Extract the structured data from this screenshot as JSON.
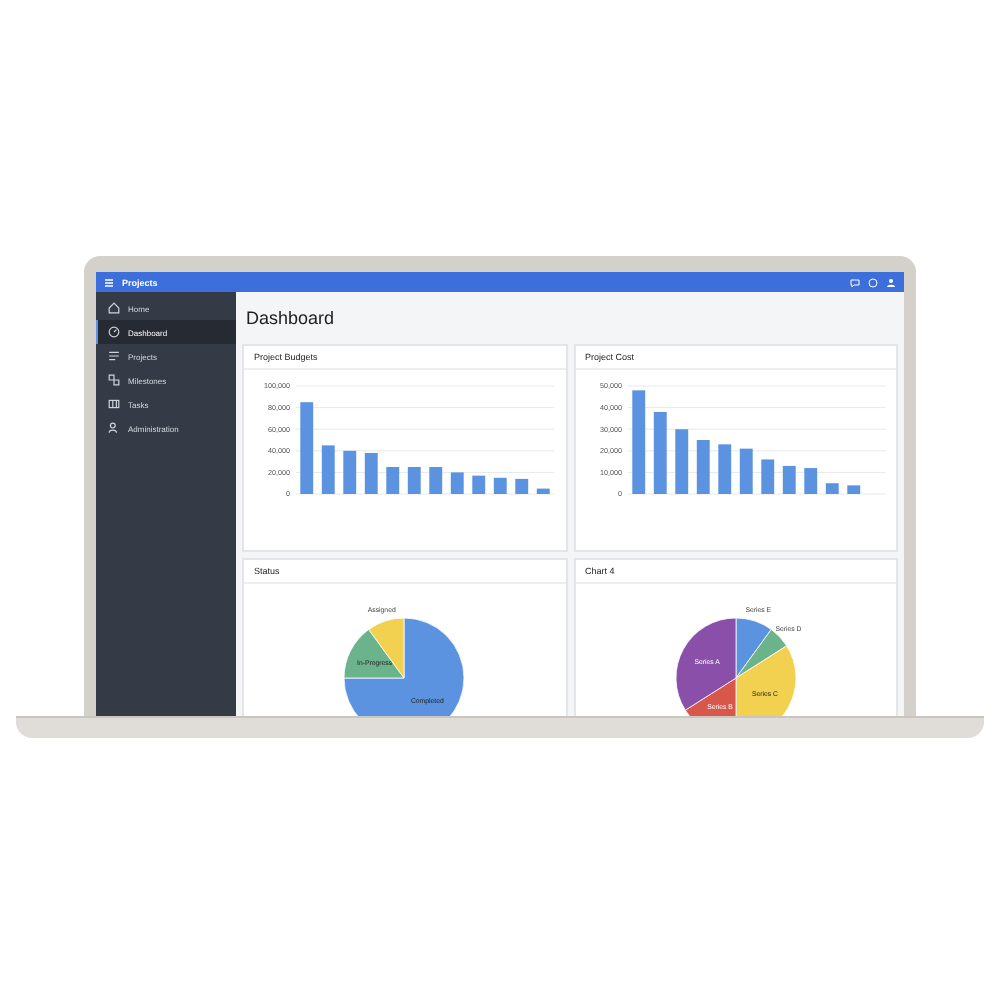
{
  "header": {
    "title": "Projects"
  },
  "sidebar": {
    "items": [
      {
        "label": "Home",
        "selected": false
      },
      {
        "label": "Dashboard",
        "selected": true
      },
      {
        "label": "Projects",
        "selected": false
      },
      {
        "label": "Milestones",
        "selected": false
      },
      {
        "label": "Tasks",
        "selected": false
      },
      {
        "label": "Administration",
        "selected": false
      }
    ]
  },
  "page": {
    "title": "Dashboard"
  },
  "cards": [
    {
      "title": "Project Budgets",
      "chart_data": {
        "type": "bar",
        "grid": true,
        "yticks": [
          {
            "value": 0,
            "label": "0"
          },
          {
            "value": 20000,
            "label": "20,000"
          },
          {
            "value": 40000,
            "label": "40,000"
          },
          {
            "value": 60000,
            "label": "60,000"
          },
          {
            "value": 80000,
            "label": "80,000"
          },
          {
            "value": 100000,
            "label": "100,000"
          }
        ],
        "ylim": [
          0,
          100000
        ],
        "series": [
          {
            "color": "#5b93e0",
            "values": [
              85000,
              45000,
              40000,
              38000,
              25000,
              25000,
              25000,
              20000,
              17000,
              15000,
              14000,
              5000
            ]
          }
        ]
      }
    },
    {
      "title": "Project Cost",
      "chart_data": {
        "type": "bar",
        "grid": true,
        "yticks": [
          {
            "value": 0,
            "label": "0"
          },
          {
            "value": 10000,
            "label": "10,000"
          },
          {
            "value": 20000,
            "label": "20,000"
          },
          {
            "value": 30000,
            "label": "30,000"
          },
          {
            "value": 40000,
            "label": "40,000"
          },
          {
            "value": 50000,
            "label": "50,000"
          }
        ],
        "ylim": [
          0,
          50000
        ],
        "series": [
          {
            "color": "#5b93e0",
            "values": [
              48000,
              38000,
              30000,
              25000,
              23000,
              21000,
              16000,
              13000,
              12000,
              5000,
              4000,
              0
            ]
          }
        ]
      }
    },
    {
      "title": "Status",
      "chart_data": {
        "type": "pie",
        "categories": [
          "Completed",
          "In-Progress",
          "Assigned"
        ],
        "values": [
          75,
          15,
          10
        ],
        "colors": [
          "#5b93e0",
          "#6bb38a",
          "#f2d150"
        ]
      }
    },
    {
      "title": "Chart 4",
      "chart_data": {
        "type": "pie",
        "categories": [
          "Series E",
          "Series D",
          "Series C",
          "Series B",
          "Series A"
        ],
        "values": [
          10,
          6,
          34,
          16,
          34
        ],
        "colors": [
          "#5b93e0",
          "#6bb38a",
          "#f2d150",
          "#d9574a",
          "#8a4fa8"
        ]
      }
    }
  ]
}
